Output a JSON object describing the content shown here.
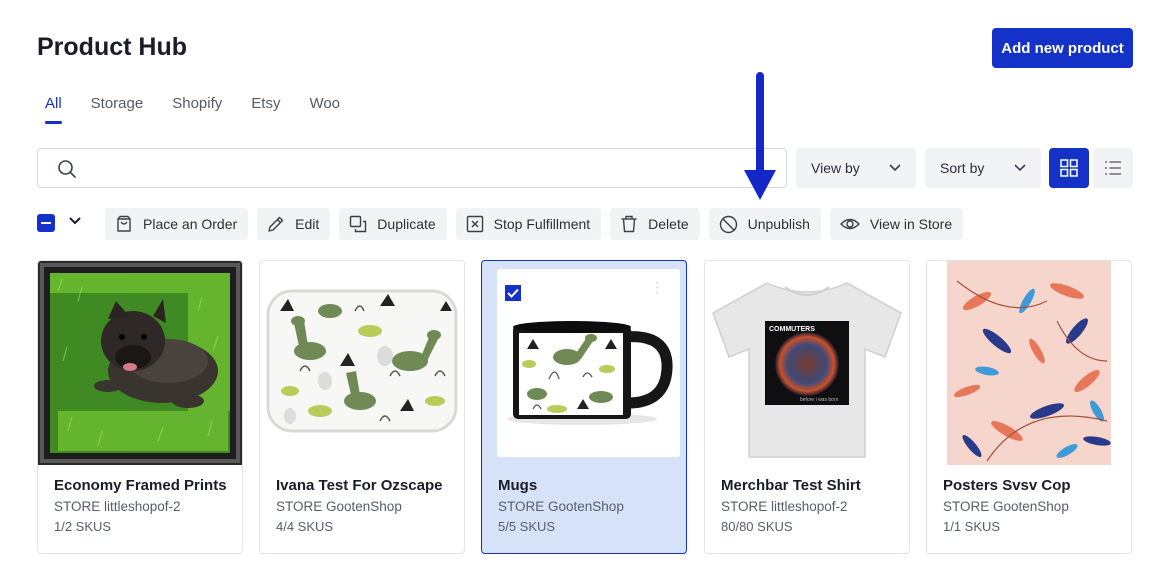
{
  "header": {
    "title": "Product Hub",
    "add_button": "Add new product"
  },
  "tabs": [
    {
      "label": "All",
      "active": true
    },
    {
      "label": "Storage",
      "active": false
    },
    {
      "label": "Shopify",
      "active": false
    },
    {
      "label": "Etsy",
      "active": false
    },
    {
      "label": "Woo",
      "active": false
    }
  ],
  "search": {
    "placeholder": "",
    "value": ""
  },
  "filters": {
    "view_by": "View by",
    "sort_by": "Sort by",
    "view_mode": "grid"
  },
  "bulk_actions": [
    {
      "label": "Place an Order",
      "icon": "bag-icon"
    },
    {
      "label": "Edit",
      "icon": "pencil-icon"
    },
    {
      "label": "Duplicate",
      "icon": "duplicate-icon"
    },
    {
      "label": "Stop Fulfillment",
      "icon": "x-box-icon"
    },
    {
      "label": "Delete",
      "icon": "trash-icon"
    },
    {
      "label": "Unpublish",
      "icon": "ban-icon"
    },
    {
      "label": "View in Store",
      "icon": "eye-icon"
    }
  ],
  "products": [
    {
      "name": "Economy Framed Prints",
      "store": "STORE littleshopof-2",
      "skus": "1/2 SKUS",
      "selected": false,
      "image": "framed-print-dog"
    },
    {
      "name": "Ivana Test For Ozscape",
      "store": "STORE GootenShop",
      "skus": "4/4 SKUS",
      "selected": false,
      "image": "dinosaur-bath-mat"
    },
    {
      "name": "Mugs",
      "store": "STORE GootenShop",
      "skus": "5/5 SKUS",
      "selected": true,
      "image": "dinosaur-mug"
    },
    {
      "name": "Merchbar Test Shirt",
      "store": "STORE littleshopof-2",
      "skus": "80/80 SKUS",
      "selected": false,
      "image": "commuters-shirt"
    },
    {
      "name": "Posters Svsv Cop",
      "store": "STORE GootenShop",
      "skus": "1/1 SKUS",
      "selected": false,
      "image": "floral-poster"
    }
  ],
  "shirt_print": {
    "band": "COMMUTERS",
    "caption": "before i was born"
  },
  "colors": {
    "accent": "#1432c8",
    "selected_card": "#d6e2f8",
    "chip": "#f2f3f5"
  }
}
